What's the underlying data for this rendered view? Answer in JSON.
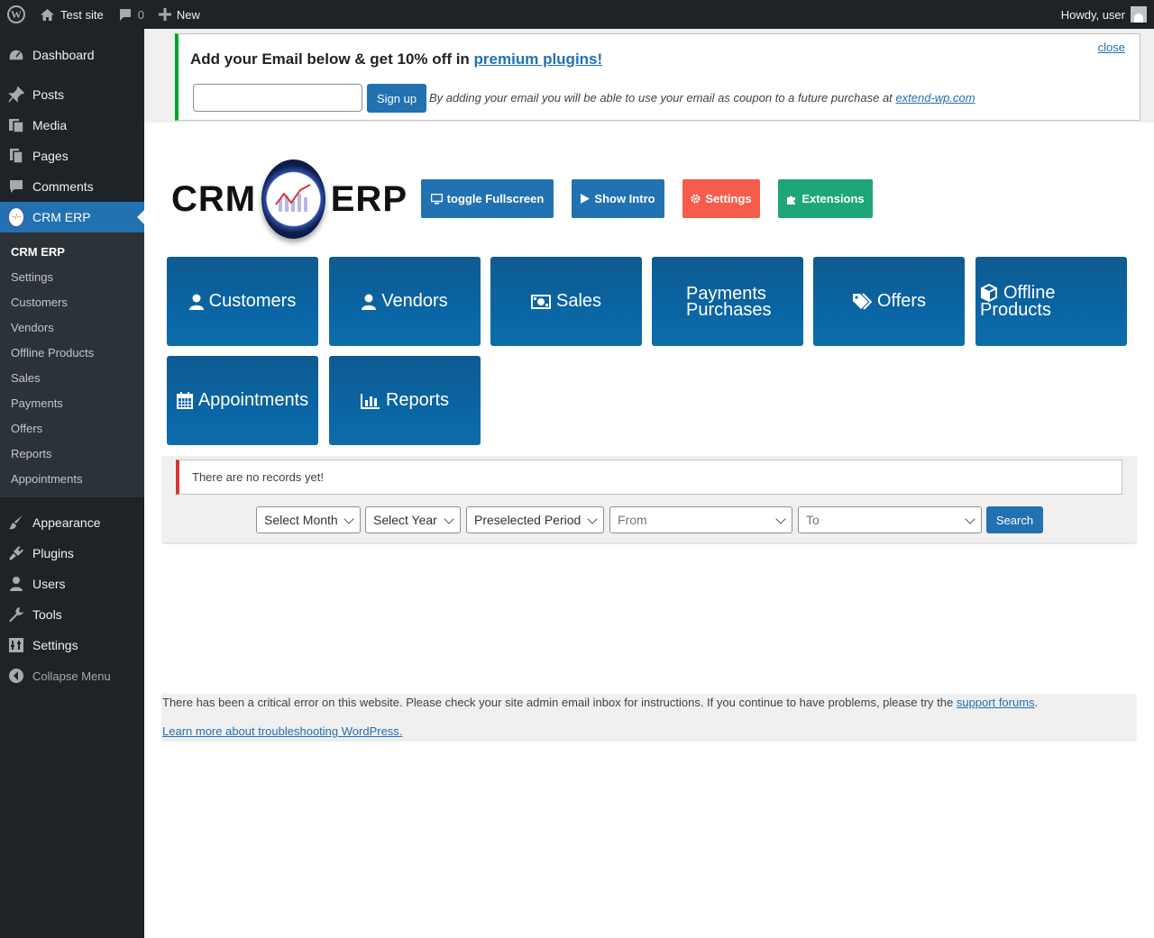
{
  "adminbar": {
    "site_name": "Test site",
    "comments_count": "0",
    "new_label": "New",
    "greeting": "Howdy, user"
  },
  "sidebar": {
    "items": [
      {
        "label": "Dashboard",
        "icon": "dashboard-icon"
      },
      {
        "label": "Posts",
        "icon": "pin-icon"
      },
      {
        "label": "Media",
        "icon": "media-icon"
      },
      {
        "label": "Pages",
        "icon": "pages-icon"
      },
      {
        "label": "Comments",
        "icon": "comment-icon"
      },
      {
        "label": "CRM ERP",
        "icon": "crm-erp-icon"
      }
    ],
    "submenu": [
      "CRM ERP",
      "Settings",
      "Customers",
      "Vendors",
      "Offline Products",
      "Sales",
      "Payments",
      "Offers",
      "Reports",
      "Appointments"
    ],
    "items_after": [
      {
        "label": "Appearance",
        "icon": "brush-icon"
      },
      {
        "label": "Plugins",
        "icon": "plug-icon"
      },
      {
        "label": "Users",
        "icon": "user-icon"
      },
      {
        "label": "Tools",
        "icon": "wrench-icon"
      },
      {
        "label": "Settings",
        "icon": "settings-icon"
      }
    ],
    "collapse_label": "Collapse Menu"
  },
  "promo": {
    "title_prefix": "Add your Email below & get 10% off in",
    "title_link": "premium plugins!",
    "close_label": "close",
    "signup_label": "Sign up",
    "desc_prefix": "By adding your email you will be able to use your email as coupon to a future purchase at",
    "desc_link": "extend-wp.com"
  },
  "logo": {
    "left_word": "CRM",
    "right_word": "ERP"
  },
  "top_buttons": {
    "fullscreen": "toggle Fullscreen",
    "intro": "Show Intro",
    "settings": "Settings",
    "extensions": "Extensions"
  },
  "colors": {
    "wp_blue": "#2271b1",
    "settings_red": "#f55d4a",
    "extensions_green": "#1ea67a",
    "tile_blue": "#0a65a4",
    "notice_green": "#00a32a",
    "error_red": "#d63638"
  },
  "tiles": {
    "customers": "Customers",
    "vendors": "Vendors",
    "sales": "Sales",
    "payments_line1": "Payments",
    "payments_line2": "Purchases",
    "offers": "Offers",
    "offline_line1": "Offline",
    "offline_line2": "Products",
    "appointments": "Appointments",
    "reports": "Reports"
  },
  "records": {
    "message": "There are no records yet!",
    "select_month": "Select Month",
    "select_year": "Select Year",
    "preselected_period": "Preselected Period",
    "from": "From",
    "to": "To",
    "search": "Search"
  },
  "error": {
    "text": "There has been a critical error on this website. Please check your site admin email inbox for instructions. If you continue to have problems, please try the",
    "link": "support forums",
    "learn_more": "Learn more about troubleshooting WordPress."
  }
}
